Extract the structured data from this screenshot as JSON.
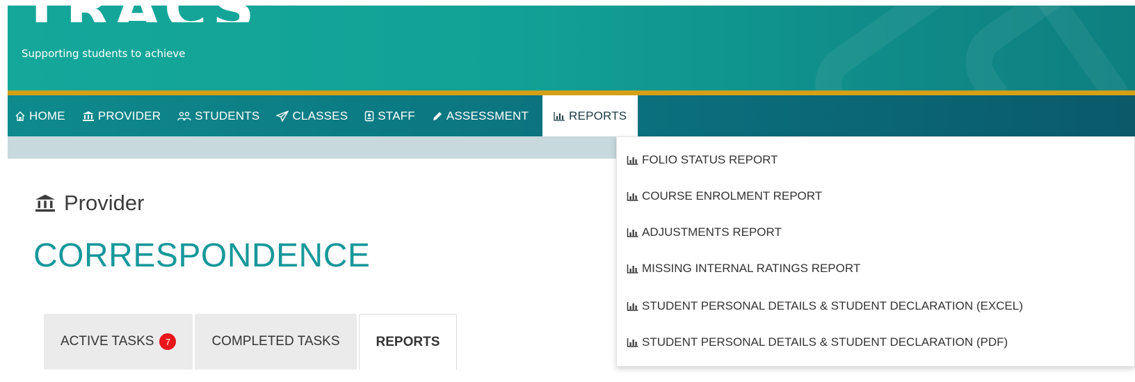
{
  "header": {
    "logo": "TRACS",
    "tagline": "Supporting students to achieve"
  },
  "nav": {
    "items": [
      {
        "label": "HOME",
        "icon": "home-icon"
      },
      {
        "label": "PROVIDER",
        "icon": "institution-icon"
      },
      {
        "label": "STUDENTS",
        "icon": "users-icon"
      },
      {
        "label": "CLASSES",
        "icon": "paper-plane-icon"
      },
      {
        "label": "STAFF",
        "icon": "badge-icon"
      },
      {
        "label": "ASSESSMENT",
        "icon": "pencil-icon"
      },
      {
        "label": "REPORTS",
        "icon": "bar-chart-icon",
        "active": true
      }
    ]
  },
  "main": {
    "section": "Provider",
    "title": "CORRESPONDENCE",
    "tabs": [
      {
        "label": "ACTIVE TASKS",
        "badge": "7"
      },
      {
        "label": "COMPLETED TASKS"
      },
      {
        "label": "REPORTS",
        "selected": true
      }
    ]
  },
  "reports_menu": {
    "items": [
      "FOLIO STATUS REPORT",
      "COURSE ENROLMENT REPORT",
      "ADJUSTMENTS REPORT",
      "MISSING INTERNAL RATINGS REPORT",
      "STUDENT PERSONAL DETAILS & STUDENT DECLARATION (EXCEL)",
      "STUDENT PERSONAL DETAILS & STUDENT DECLARATION (PDF)"
    ]
  },
  "colors": {
    "header_teal": "#15a79a",
    "nav_teal": "#0b6e7c",
    "gold": "#d4a017",
    "title_teal": "#17989b",
    "badge_red": "#e8151b"
  }
}
